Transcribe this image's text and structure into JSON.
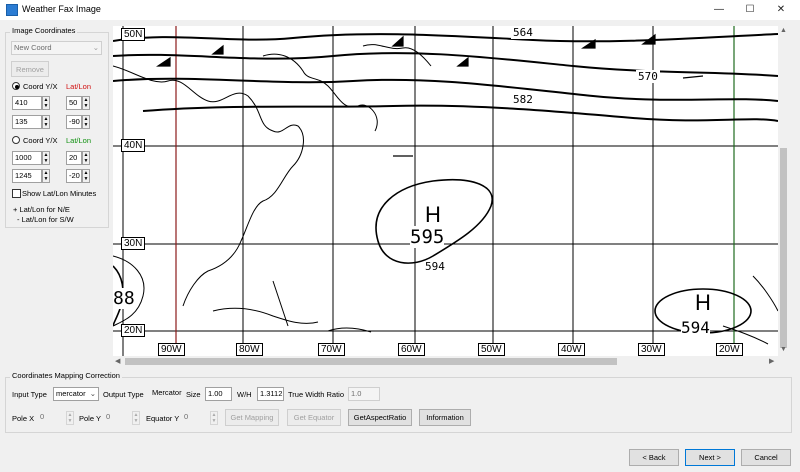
{
  "window": {
    "title": "Weather Fax Image",
    "minimize": "—",
    "maximize": "☐",
    "close": "✕"
  },
  "image_coordinates": {
    "group_label": "Image Coordinates",
    "coord_select": "New Coord",
    "remove_label": "Remove",
    "coord1": {
      "label": "Coord Y/X",
      "latlon_label": "Lat/Lon",
      "y": "410",
      "x": "135",
      "lat": "50",
      "lon": "-90",
      "checked": true
    },
    "coord2": {
      "label": "Coord Y/X",
      "latlon_label": "Lat/Lon",
      "y": "1000",
      "x": "1245",
      "lat": "20",
      "lon": "-20",
      "checked": false
    },
    "show_minutes_label": "Show Lat/Lon Minutes",
    "note_line1": "+ Lat/Lon for N/E",
    "note_line2": "- Lat/Lon for S/W"
  },
  "mapping": {
    "group_label": "Coordinates Mapping Correction",
    "input_type_label": "Input Type",
    "input_type_value": "mercator",
    "output_type_label": "Output Type",
    "output_type_value": "Mercator",
    "size_label": "Size",
    "size_value": "1.00",
    "wh_label": "W/H",
    "wh_value": "1.3112",
    "true_width_label": "True Width Ratio",
    "true_width_value": "1.0",
    "pole_x_label": "Pole X",
    "pole_x_value": "0",
    "pole_y_label": "Pole Y",
    "pole_y_value": "0",
    "equator_y_label": "Equator Y",
    "equator_y_value": "0",
    "get_mapping": "Get Mapping",
    "get_equator": "Get Equator",
    "get_aspect": "GetAspectRatio",
    "information": "Information"
  },
  "footer": {
    "back": "< Back",
    "next": "Next >",
    "cancel": "Cancel"
  },
  "map": {
    "lat_labels": [
      "50N",
      "40N",
      "30N",
      "20N"
    ],
    "lon_labels": [
      "90W",
      "80W",
      "70W",
      "60W",
      "50W",
      "40W",
      "30W",
      "20W"
    ],
    "contour_labels": [
      "564",
      "570",
      "582"
    ],
    "high1_letter": "H",
    "high1_value": "595",
    "high1_contour": "594",
    "high2_letter": "H",
    "high2_value": "594",
    "side_label": "88",
    "colors": {
      "lon_marker_red": "#8b1a1a",
      "lon_marker_green": "#1e6b1e"
    }
  }
}
